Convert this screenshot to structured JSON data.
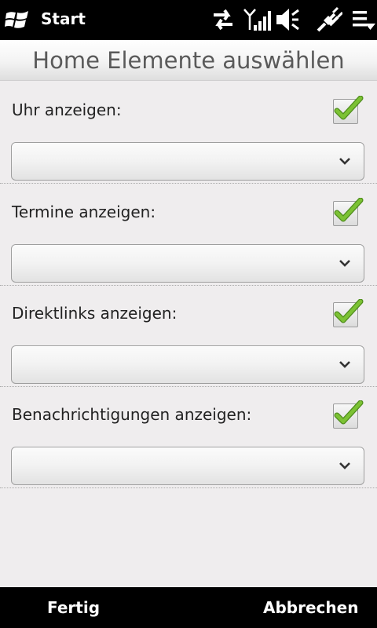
{
  "statusbar": {
    "start_label": "Start",
    "icons": [
      "windows-logo-icon",
      "data-transfer-icon",
      "signal-icon",
      "volume-mute-icon",
      "usb-power-icon",
      "menu-icon"
    ]
  },
  "title": "Home Elemente auswählen",
  "sections": [
    {
      "label": "Uhr anzeigen:",
      "checked": true,
      "dropdown_value": ""
    },
    {
      "label": "Termine anzeigen:",
      "checked": true,
      "dropdown_value": ""
    },
    {
      "label": "Direktlinks anzeigen:",
      "checked": true,
      "dropdown_value": ""
    },
    {
      "label": "Benachrichtigungen anzeigen:",
      "checked": true,
      "dropdown_value": ""
    }
  ],
  "softkeys": {
    "left": "Fertig",
    "right": "Abbrechen"
  },
  "colors": {
    "check_green": "#6fb22a",
    "bar_black": "#000000",
    "background": "#efedee"
  }
}
